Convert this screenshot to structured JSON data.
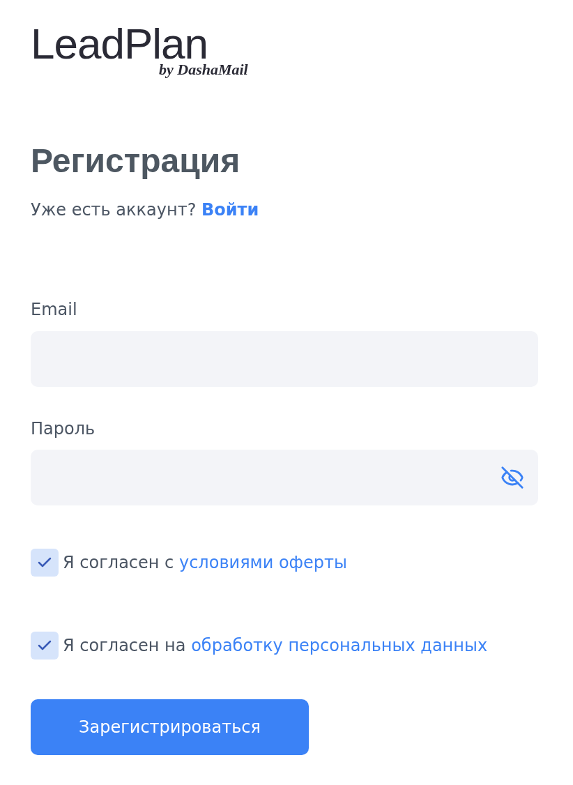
{
  "logo": {
    "name": "LeadPlan",
    "tagline": "by DashaMail"
  },
  "title": "Регистрация",
  "login_prompt": {
    "text": "Уже есть аккаунт?",
    "link": "Войти"
  },
  "fields": [
    {
      "label": "Email",
      "kind": "text"
    },
    {
      "label": "Пароль",
      "kind": "password",
      "password_hidden": true
    }
  ],
  "agreements": [
    {
      "text": "Я согласен с",
      "link": "условиями оферты",
      "checked": true
    },
    {
      "text": "Я согласен на",
      "link": "обработку персональных данных",
      "checked": true
    }
  ],
  "submit_button": "Зарегистрироваться"
}
